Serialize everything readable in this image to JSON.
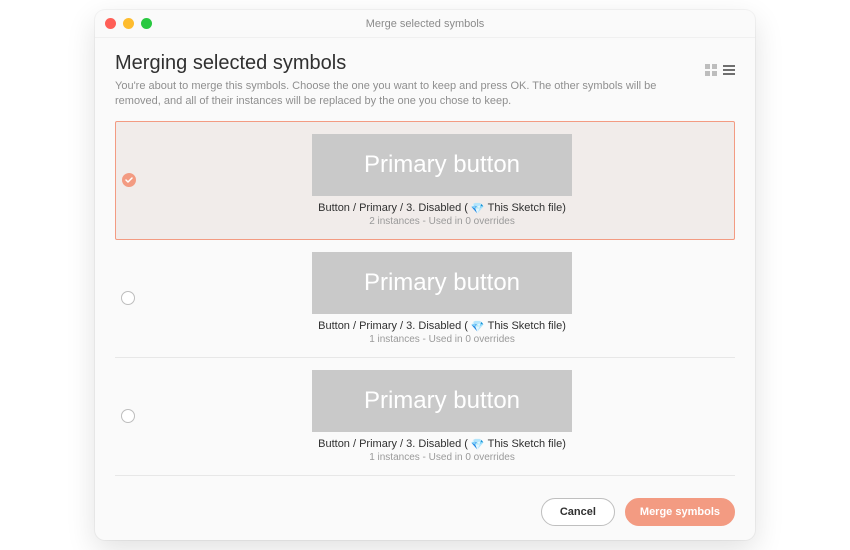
{
  "window": {
    "title": "Merge selected symbols"
  },
  "header": {
    "heading": "Merging selected symbols",
    "description": "You're about to merge this symbols. Choose the one you want to keep and press OK. The other symbols will be removed, and all of their instances will be replaced by the one you chose to keep."
  },
  "view": {
    "grid_active": false,
    "list_active": true
  },
  "symbols": [
    {
      "selected": true,
      "thumb_label": "Primary button",
      "path_prefix": "Button / Primary / 3. Disabled (",
      "file_label": "This Sketch file)",
      "usage": "2 instances - Used in 0 overrides"
    },
    {
      "selected": false,
      "thumb_label": "Primary button",
      "path_prefix": "Button / Primary / 3. Disabled (",
      "file_label": "This Sketch file)",
      "usage": "1 instances - Used in 0 overrides"
    },
    {
      "selected": false,
      "thumb_label": "Primary button",
      "path_prefix": "Button / Primary / 3. Disabled (",
      "file_label": "This Sketch file)",
      "usage": "1 instances - Used in 0 overrides"
    }
  ],
  "footer": {
    "cancel_label": "Cancel",
    "merge_label": "Merge symbols"
  },
  "colors": {
    "accent": "#f39b82"
  }
}
